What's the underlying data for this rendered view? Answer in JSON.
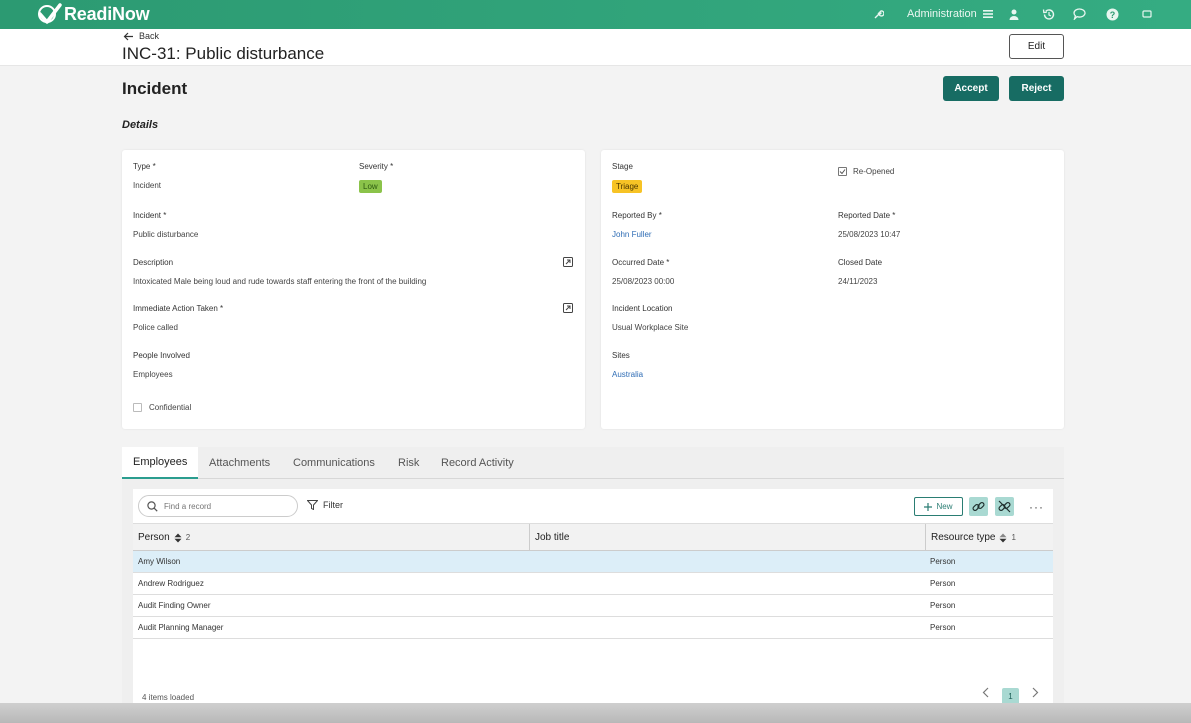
{
  "app": {
    "logo_text": "ReadiNow",
    "admin_label": "Administration"
  },
  "header": {
    "back_label": "Back",
    "title": "INC-31: Public disturbance",
    "edit_label": "Edit"
  },
  "section": {
    "title": "Incident",
    "accept_label": "Accept",
    "reject_label": "Reject",
    "details_label": "Details"
  },
  "left_card": {
    "type_label": "Type *",
    "type_value": "Incident",
    "severity_label": "Severity *",
    "severity_value": "Low",
    "incident_label": "Incident *",
    "incident_value": "Public disturbance",
    "description_label": "Description",
    "description_value": "Intoxicated Male being loud and rude towards staff entering the front of the building",
    "action_label": "Immediate Action Taken *",
    "action_value": "Police called",
    "people_label": "People Involved",
    "people_value": "Employees",
    "confidential_label": "Confidential",
    "confidential_checked": false
  },
  "right_card": {
    "stage_label": "Stage",
    "stage_value": "Triage",
    "reopened_label": "Re-Opened",
    "reopened_checked": true,
    "reported_by_label": "Reported By *",
    "reported_by_value": "John Fuller",
    "reported_date_label": "Reported Date *",
    "reported_date_value": "25/08/2023 10:47",
    "occurred_label": "Occurred Date *",
    "occurred_value": "25/08/2023 00:00",
    "closed_label": "Closed Date",
    "closed_value": "24/11/2023",
    "location_label": "Incident Location",
    "location_value": "Usual Workplace Site",
    "sites_label": "Sites",
    "sites_value": "Australia"
  },
  "tabs": [
    {
      "label": "Employees",
      "active": true
    },
    {
      "label": "Attachments",
      "active": false
    },
    {
      "label": "Communications",
      "active": false
    },
    {
      "label": "Risk",
      "active": false
    },
    {
      "label": "Record Activity",
      "active": false
    }
  ],
  "grid": {
    "search_placeholder": "Find a record",
    "filter_label": "Filter",
    "new_label": "New",
    "columns": [
      {
        "label": "Person",
        "sort_index": "2"
      },
      {
        "label": "Job title",
        "sort_index": ""
      },
      {
        "label": "Resource type",
        "sort_index": "1"
      }
    ],
    "rows": [
      {
        "person": "Amy Wilson",
        "job_title": "",
        "resource_type": "Person"
      },
      {
        "person": "Andrew Rodriguez",
        "job_title": "",
        "resource_type": "Person"
      },
      {
        "person": "Audit Finding Owner",
        "job_title": "",
        "resource_type": "Person"
      },
      {
        "person": "Audit Planning Manager",
        "job_title": "",
        "resource_type": "Person"
      }
    ],
    "footer_text": "4 items loaded",
    "current_page": "1"
  },
  "colors": {
    "topbar": "#2c9a72",
    "primary_button": "#176c63",
    "accent": "#2a9d8f",
    "badge_low": "#8bc34a",
    "badge_triage": "#f7c325",
    "link": "#2f6db5",
    "selected_row": "#dceef8"
  },
  "icons": {
    "topbar": [
      "wrench-icon",
      "menu-icon",
      "user-icon",
      "history-icon",
      "chat-icon",
      "help-icon",
      "fullscreen-icon"
    ]
  }
}
